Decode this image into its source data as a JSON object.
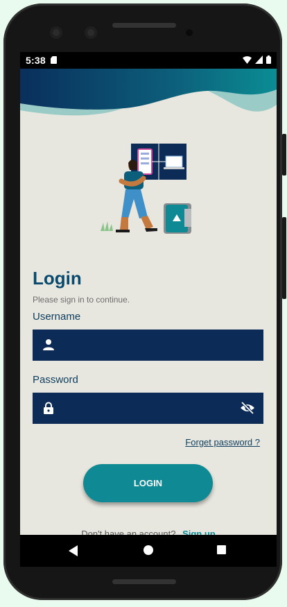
{
  "status": {
    "time": "5:38"
  },
  "login": {
    "title": "Login",
    "subtitle": "Please sign in to continue.",
    "username_label": "Username",
    "username_value": "",
    "password_label": "Password",
    "password_value": "",
    "forgot_label": "Forget password ?",
    "login_button": "LOGIN",
    "signup_prompt": "Don't have an account?",
    "signup_link": "Sign up"
  },
  "icons": {
    "username": "person-icon",
    "password": "lock-icon",
    "visibility": "eye-off-icon"
  },
  "colors": {
    "accent": "#0f8a95",
    "field_bg": "#0c2c57",
    "title": "#0a4a6e",
    "background": "#e8e7df"
  }
}
